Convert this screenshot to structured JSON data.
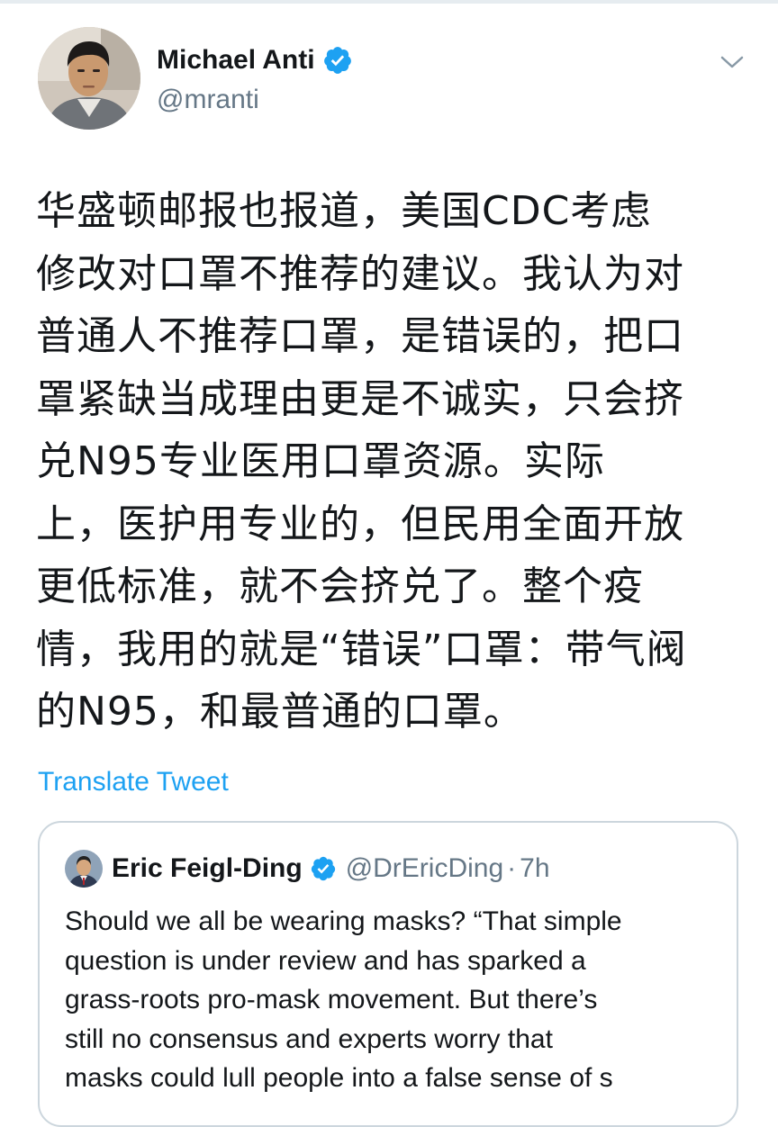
{
  "tweet": {
    "author": {
      "display_name": "Michael Anti",
      "handle": "@mranti",
      "verified": true
    },
    "text_lines": [
      "华盛顿邮报也报道，美国CDC考虑",
      "修改对口罩不推荐的建议。我认为对",
      "普通人不推荐口罩，是错误的，把口",
      "罩紧缺当成理由更是不诚实，只会挤",
      "兑N95专业医用口罩资源。实际",
      "上，医护用专业的，但民用全面开放",
      "更低标准，就不会挤兑了。整个疫",
      "情，我用的就是“错误”口罩：带气阀",
      "的N95，和最普通的口罩。"
    ],
    "translate_label": "Translate Tweet",
    "menu_icon": "chevron-down-icon"
  },
  "quoted_tweet": {
    "author": {
      "display_name": "Eric Feigl-Ding",
      "handle": "@DrEricDing",
      "verified": true
    },
    "separator": "·",
    "time": "7h",
    "text_lines": [
      "Should we all be wearing masks? “That simple",
      "question is under review and has sparked a",
      "grass-roots pro-mask movement. But there’s",
      "still no consensus and experts worry that",
      "masks could lull people into a false sense of s"
    ]
  },
  "colors": {
    "text": "#14171a",
    "secondary": "#657786",
    "link": "#1da1f2",
    "border": "#ccd6dd",
    "verified_badge": "#1da1f2"
  }
}
